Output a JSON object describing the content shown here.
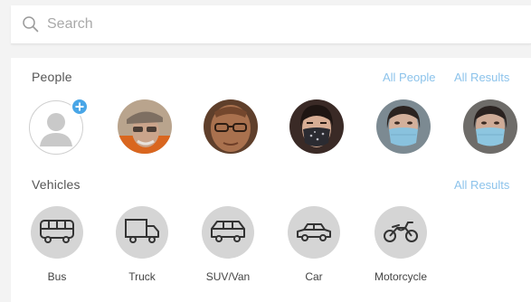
{
  "search": {
    "placeholder": "Search"
  },
  "people": {
    "title": "People",
    "all_people_label": "All People",
    "all_results_label": "All Results"
  },
  "vehicles": {
    "title": "Vehicles",
    "all_results_label": "All Results",
    "items": [
      {
        "label": "Bus",
        "icon": "bus-icon"
      },
      {
        "label": "Truck",
        "icon": "truck-icon"
      },
      {
        "label": "SUV/Van",
        "icon": "suv-van-icon"
      },
      {
        "label": "Car",
        "icon": "car-icon"
      },
      {
        "label": "Motorcycle",
        "icon": "motorcycle-icon"
      }
    ]
  },
  "colors": {
    "accent": "#49a6e7",
    "link": "#8cc3eb",
    "vehicle_bg": "#d5d5d5"
  }
}
